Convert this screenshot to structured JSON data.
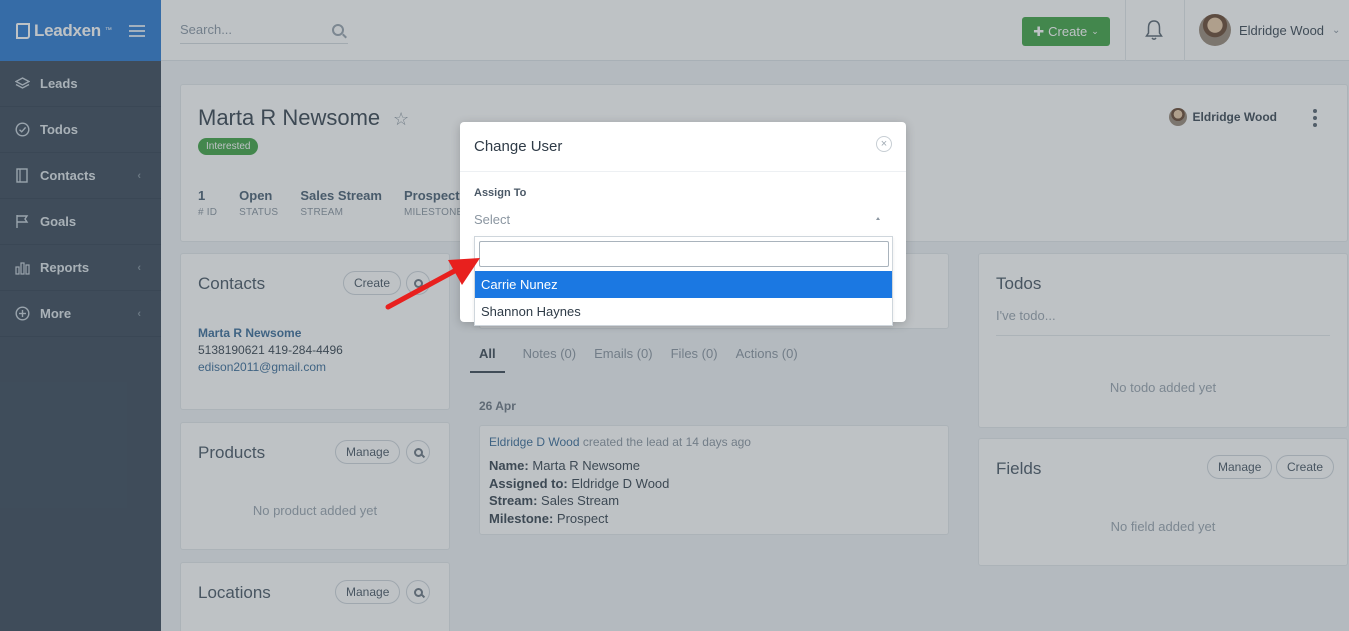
{
  "app": {
    "name": "Leadxen",
    "tm": "™"
  },
  "sidebar": {
    "items": [
      {
        "label": "Leads",
        "icon": "layers-icon"
      },
      {
        "label": "Todos",
        "icon": "check-circle-icon"
      },
      {
        "label": "Contacts",
        "icon": "contacts-book-icon",
        "has_submenu": true
      },
      {
        "label": "Goals",
        "icon": "flag-icon"
      },
      {
        "label": "Reports",
        "icon": "bar-chart-icon",
        "has_submenu": true
      },
      {
        "label": "More",
        "icon": "plus-circle-icon",
        "has_submenu": true
      }
    ]
  },
  "topbar": {
    "search_placeholder": "Search...",
    "create_label": "Create",
    "user_name": "Eldridge Wood"
  },
  "lead": {
    "name": "Marta R Newsome",
    "status_badge": "Interested",
    "owner": "Eldridge Wood",
    "stats": [
      {
        "value": "1",
        "label": "# ID"
      },
      {
        "value": "Open",
        "label": "STATUS"
      },
      {
        "value": "Sales Stream",
        "label": "STREAM"
      },
      {
        "value": "Prospect",
        "label": "MILESTONE"
      }
    ]
  },
  "contacts_card": {
    "title": "Contacts",
    "create_label": "Create",
    "contact_name": "Marta R Newsome",
    "phones": "5138190621 419-284-4496",
    "email": "edison2011@gmail.com"
  },
  "products_card": {
    "title": "Products",
    "manage_label": "Manage",
    "empty": "No product added yet"
  },
  "locations_card": {
    "title": "Locations",
    "manage_label": "Manage"
  },
  "activity": {
    "tabs": [
      "All",
      "Notes (0)",
      "Emails (0)",
      "Files (0)",
      "Actions (0)"
    ],
    "date": "26 Apr",
    "entry": {
      "actor": "Eldridge D Wood",
      "text": "created the lead at 14 days ago",
      "fields": [
        {
          "key": "Name:",
          "value": "Marta R Newsome"
        },
        {
          "key": "Assigned to:",
          "value": "Eldridge D Wood"
        },
        {
          "key": "Stream:",
          "value": "Sales Stream"
        },
        {
          "key": "Milestone:",
          "value": "Prospect"
        }
      ]
    }
  },
  "todos_card": {
    "title": "Todos",
    "placeholder": "I've todo...",
    "empty": "No todo added yet"
  },
  "fields_card": {
    "title": "Fields",
    "manage_label": "Manage",
    "create_label": "Create",
    "empty": "No field added yet"
  },
  "modal": {
    "title": "Change User",
    "close": "×",
    "assign_label": "Assign To",
    "select_placeholder": "Select",
    "search_value": "",
    "options": [
      {
        "label": "Carrie Nunez",
        "highlighted": true
      },
      {
        "label": "Shannon Haynes",
        "highlighted": false
      }
    ]
  },
  "colors": {
    "sidebar": "#3c4b5b",
    "brand": "#2f7bd1",
    "create": "#42a548",
    "highlight": "#1b78e2",
    "annotation_arrow": "#e8201e"
  }
}
